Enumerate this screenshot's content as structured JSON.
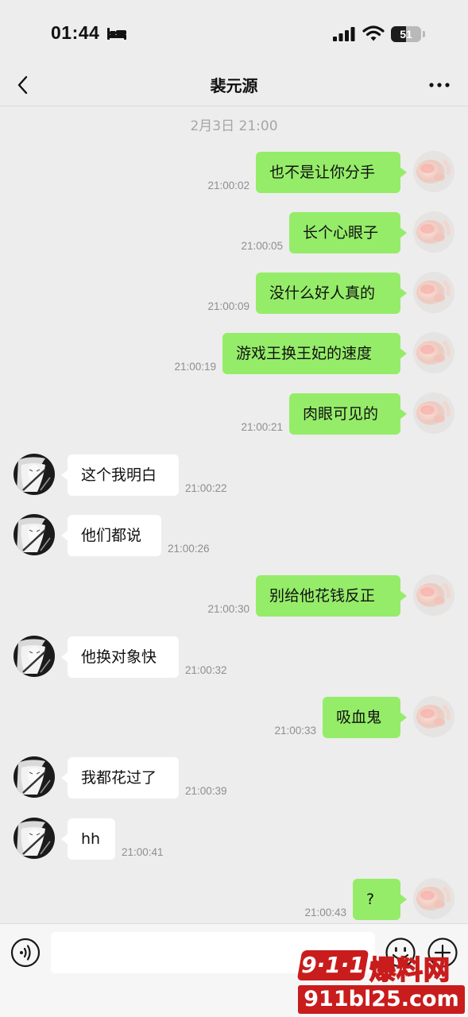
{
  "status_bar": {
    "time": "01:44",
    "battery_level": "51",
    "battery_fraction": 0.51
  },
  "nav": {
    "title": "裴元源"
  },
  "timestamp_header": "2月3日 21:00",
  "messages": [
    {
      "side": "sent",
      "text": "也不是让你分手",
      "time": "21:00:02"
    },
    {
      "side": "sent",
      "text": "长个心眼子",
      "time": "21:00:05"
    },
    {
      "side": "sent",
      "text": "没什么好人真的",
      "time": "21:00:09"
    },
    {
      "side": "sent",
      "text": "游戏王换王妃的速度",
      "time": "21:00:19"
    },
    {
      "side": "sent",
      "text": "肉眼可见的",
      "time": "21:00:21"
    },
    {
      "side": "received",
      "text": "这个我明白",
      "time": "21:00:22"
    },
    {
      "side": "received",
      "text": "他们都说",
      "time": "21:00:26"
    },
    {
      "side": "sent",
      "text": "别给他花钱反正",
      "time": "21:00:30"
    },
    {
      "side": "received",
      "text": "他换对象快",
      "time": "21:00:32"
    },
    {
      "side": "sent",
      "text": "吸血鬼",
      "time": "21:00:33"
    },
    {
      "side": "received",
      "text": "我都花过了",
      "time": "21:00:39"
    },
    {
      "side": "received",
      "text": "hh",
      "time": "21:00:41"
    },
    {
      "side": "sent",
      "text": "?",
      "time": "21:00:43"
    }
  ],
  "input": {
    "value": "",
    "placeholder": ""
  },
  "watermark": {
    "badge": "9·1·1",
    "name": "爆料网",
    "domain": "911bl25.com"
  },
  "colors": {
    "background": "#ededed",
    "sent_bubble": "#95ec69",
    "received_bubble": "#ffffff",
    "watermark_red": "#c91c1c"
  },
  "icons": {
    "back": "chevron-left-icon",
    "more": "more-dots-icon",
    "voice": "voice-icon",
    "emoji": "emoji-icon",
    "plus": "plus-icon",
    "bed": "bed-icon",
    "signal": "signal-icon",
    "wifi": "wifi-icon"
  }
}
